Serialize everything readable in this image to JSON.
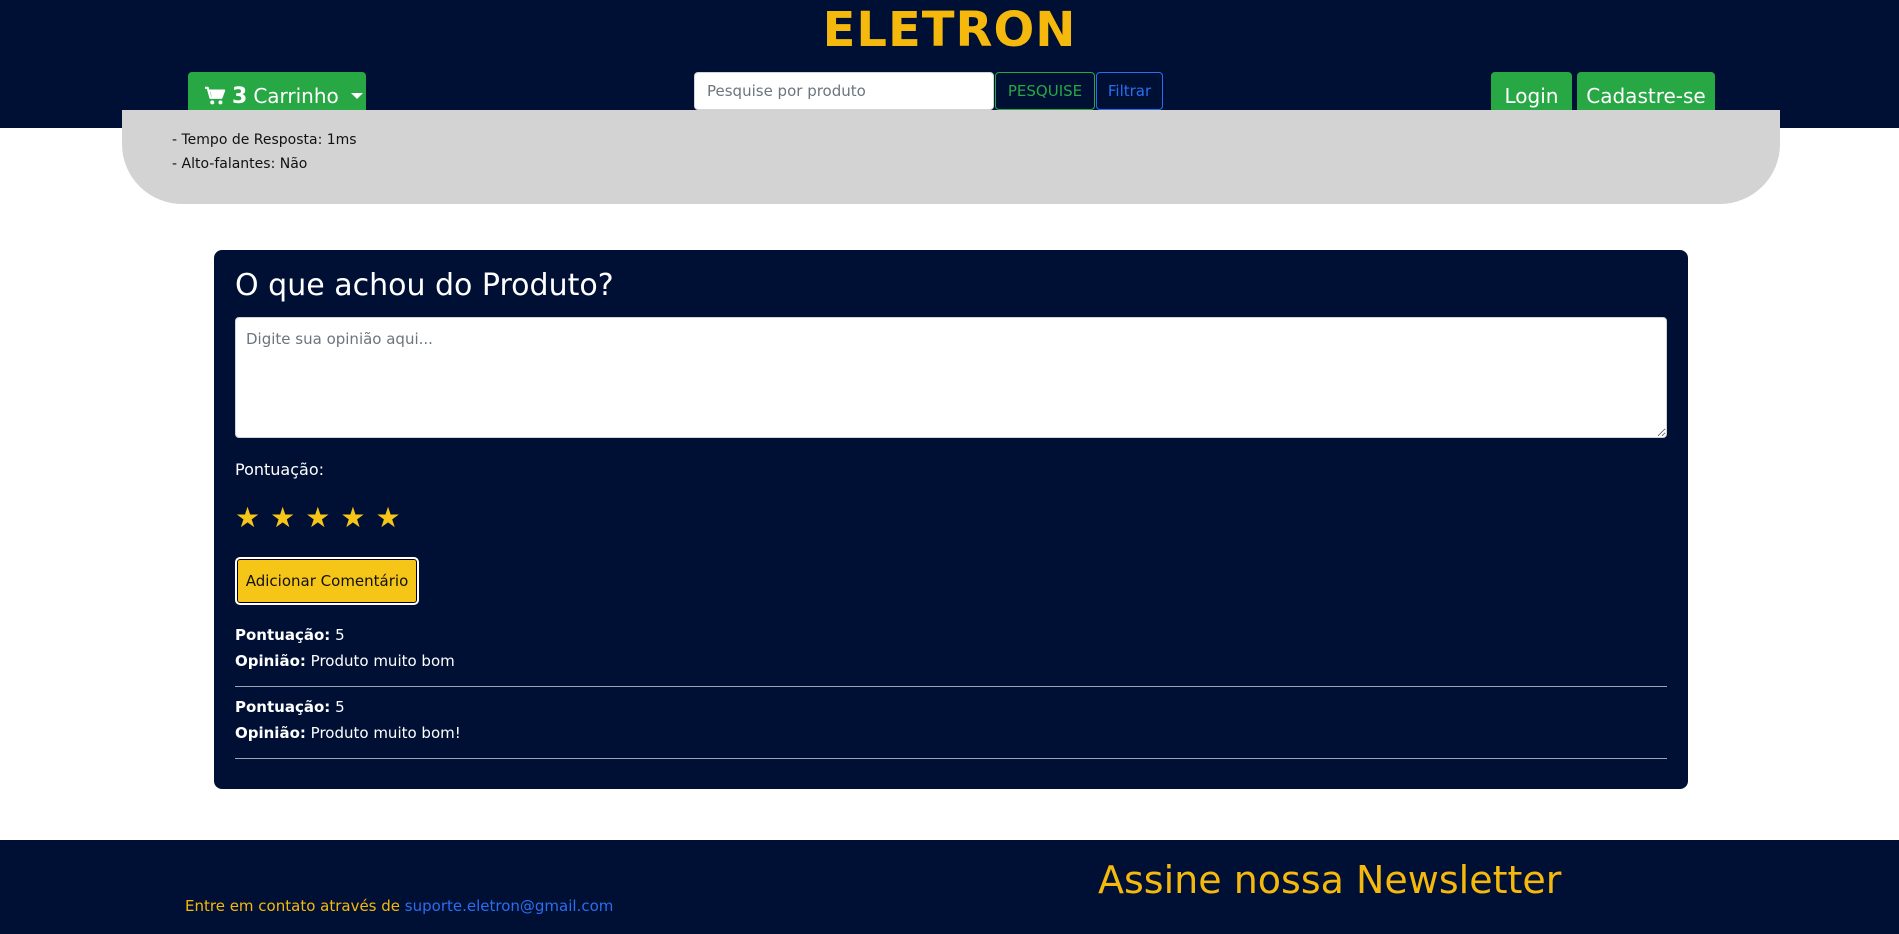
{
  "header": {
    "brand": "ELETRON",
    "cart": {
      "count": "3",
      "label": "Carrinho"
    },
    "search": {
      "placeholder": "Pesquise por produto",
      "value": ""
    },
    "search_button": "PESQUISE",
    "filter_button": "Filtrar",
    "login_button": "Login",
    "signup_button": "Cadastre-se"
  },
  "specs": {
    "lines": [
      "- Tempo de Resposta: 1ms",
      "- Alto-falantes: Não"
    ]
  },
  "review": {
    "title": "O que achou do Produto?",
    "textarea_placeholder": "Digite sua opinião aqui...",
    "score_label": "Pontuação:",
    "stars": [
      "★",
      "★",
      "★",
      "★",
      "★"
    ],
    "add_button": "Adicionar Comentário",
    "comments": [
      {
        "score_label": "Pontuação:",
        "score": "5",
        "opinion_label": "Opinião:",
        "opinion": "Produto muito bom"
      },
      {
        "score_label": "Pontuação:",
        "score": "5",
        "opinion_label": "Opinião:",
        "opinion": "Produto muito bom!"
      }
    ]
  },
  "footer": {
    "contact_text": "Entre em contato através de",
    "contact_email": "suporte.eletron@gmail.com",
    "newsletter_title": "Assine nossa Newsletter"
  },
  "colors": {
    "navy": "#001035",
    "brand_gold": "#f5b80c",
    "green": "#28a745",
    "blue": "#2a6ef0",
    "star_yellow": "#f5c518",
    "spec_gray": "#d3d3d3"
  },
  "icons": {
    "cart": "shopping-cart-icon",
    "dropdown": "caret-down-icon",
    "star": "star-icon"
  }
}
